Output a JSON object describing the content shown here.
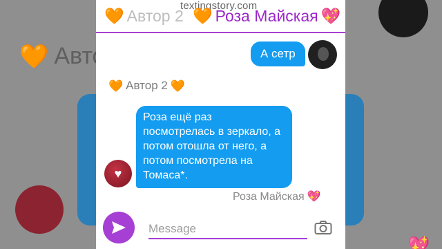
{
  "watermark": "textingstory.com",
  "header": {
    "author_label": "Автор 2",
    "contact_name": "Роза Майская"
  },
  "messages": {
    "outgoing_1": "А сетр",
    "incoming_author": "Автор 2",
    "incoming_1": "Роза ещё раз посмотрелась в зеркало, а потом отошла от него, а потом посмотрела на Томаса*.",
    "sender_name": "Роза Майская"
  },
  "composer": {
    "placeholder": "Message"
  },
  "icons": {
    "orange_heart": "orange-heart-icon",
    "pink_heart": "sparkling-heart-icon",
    "send": "send-icon",
    "camera": "camera-icon"
  },
  "colors": {
    "accent": "#a63fd3",
    "bubble": "#139cf0"
  },
  "emoji": {
    "orange_heart": "🧡",
    "sparkling_heart": "💖",
    "heart_avatar": "♥"
  }
}
